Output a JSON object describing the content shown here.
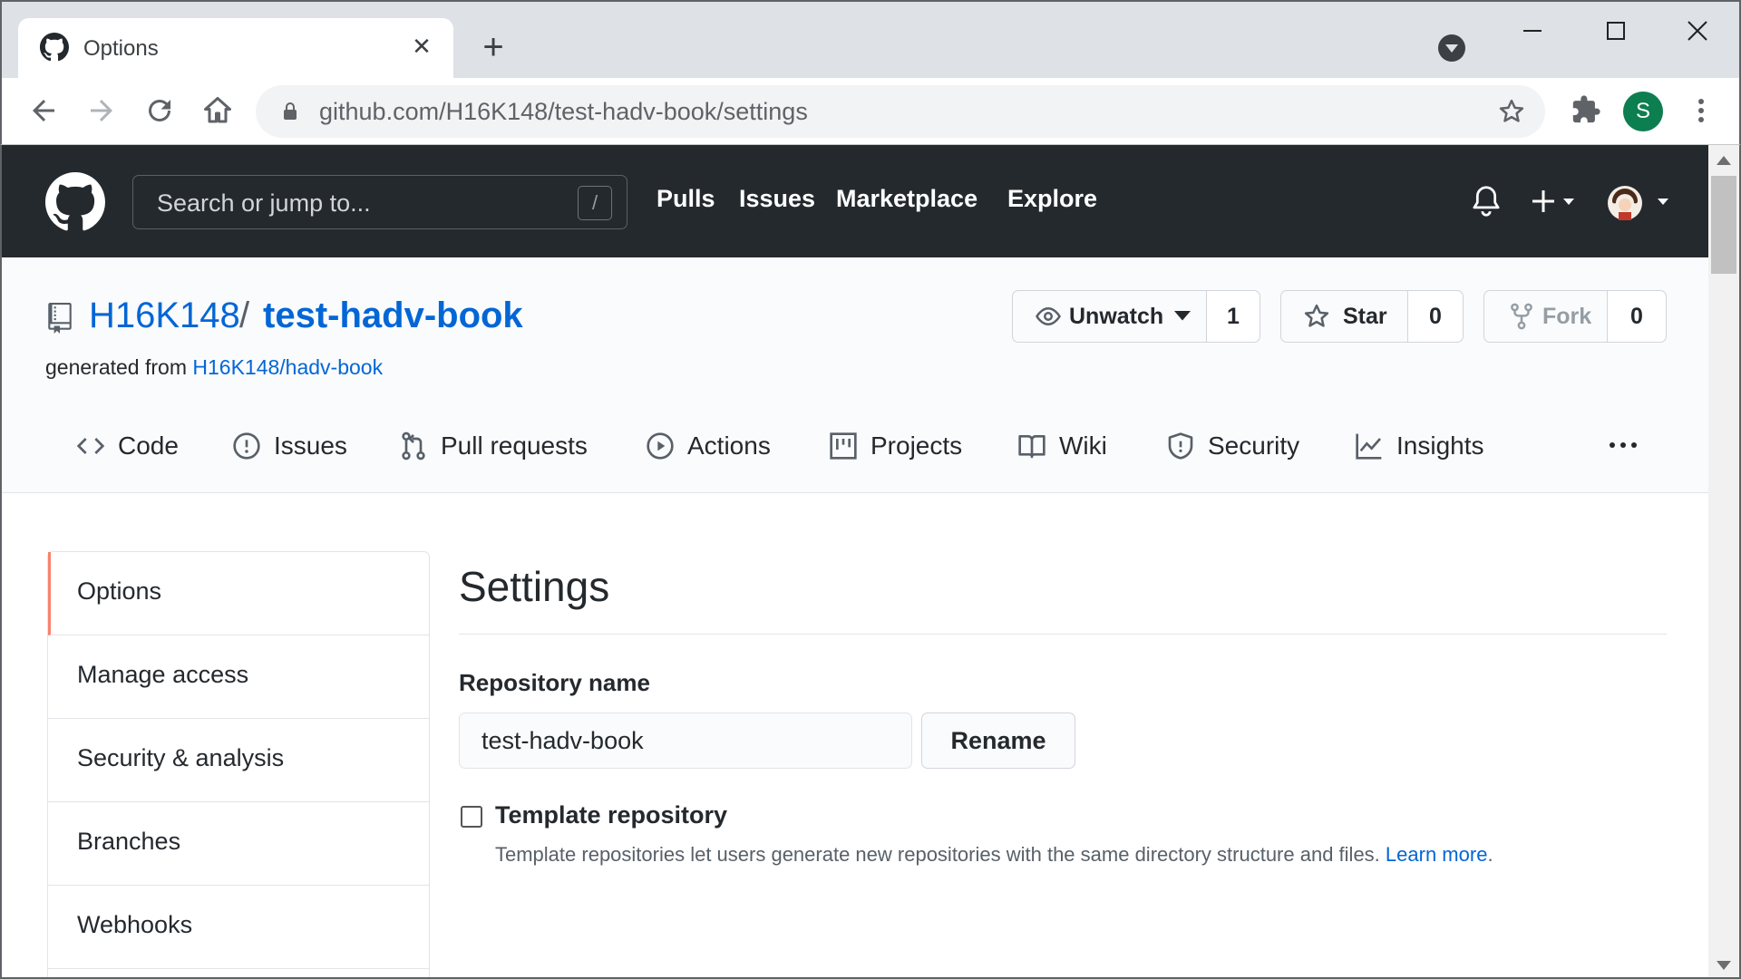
{
  "browser": {
    "tab_title": "Options",
    "url": "github.com/H16K148/test-hadv-book/settings",
    "profile_initial": "S"
  },
  "header": {
    "search_placeholder": "Search or jump to...",
    "search_shortcut": "/",
    "nav": [
      "Pulls",
      "Issues",
      "Marketplace",
      "Explore"
    ]
  },
  "repo": {
    "owner": "H16K148",
    "separator": "/",
    "name": "test-hadv-book",
    "generated_prefix": "generated from",
    "generated_from": "H16K148/hadv-book",
    "unwatch_label": "Unwatch",
    "watch_count": "1",
    "star_label": "Star",
    "star_count": "0",
    "fork_label": "Fork",
    "fork_count": "0"
  },
  "reponav": {
    "items": [
      {
        "label": "Code",
        "icon": "code-icon"
      },
      {
        "label": "Issues",
        "icon": "issue-icon"
      },
      {
        "label": "Pull requests",
        "icon": "pull-request-icon"
      },
      {
        "label": "Actions",
        "icon": "play-icon"
      },
      {
        "label": "Projects",
        "icon": "project-icon"
      },
      {
        "label": "Wiki",
        "icon": "book-icon"
      },
      {
        "label": "Security",
        "icon": "shield-icon"
      },
      {
        "label": "Insights",
        "icon": "graph-icon"
      }
    ]
  },
  "settings_menu": {
    "items": [
      "Options",
      "Manage access",
      "Security & analysis",
      "Branches",
      "Webhooks"
    ],
    "selected": "Options"
  },
  "settings": {
    "title": "Settings",
    "repo_name_label": "Repository name",
    "repo_name_value": "test-hadv-book",
    "rename_label": "Rename",
    "template_label": "Template repository",
    "template_checked": false,
    "template_note": "Template repositories let users generate new repositories with the same directory structure and files.",
    "learn_more": "Learn more",
    "learn_more_suffix": "."
  },
  "colors": {
    "header_bg": "#24292e",
    "link": "#0366d6",
    "menu_selected_accent": "#f9826c",
    "profile_bg": "#0d7e4f"
  }
}
